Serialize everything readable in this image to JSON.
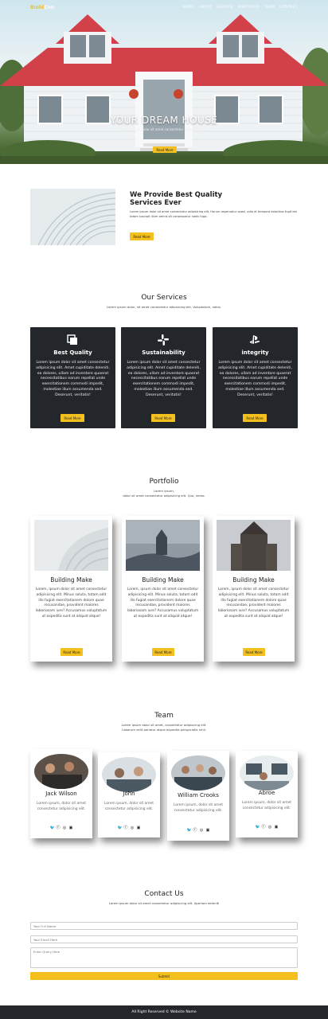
{
  "nav": {
    "brand_part1": "Build",
    "brand_part2": "Con",
    "items": [
      "HOME",
      "ABOUT",
      "SERVICE",
      "PORTFOLIO",
      "TEAM",
      "CONTACT"
    ]
  },
  "hero": {
    "title": "YOUR DREAM HOUSE",
    "subtitle": "Lorem ipsum dolor sit amet consectetur adipisicing elit.",
    "button": "Read More"
  },
  "about": {
    "title_line1": "We Provide Best Quality",
    "title_line2": "Services Ever",
    "text": "Lorem ipsum dolor sit amet consectetur adipisicing elit. Harum aspernatur quasi, odio et tempora doloribus fugit est totam suscipit illum omnis sit consequatur nobis fuga.",
    "button": "Read More"
  },
  "services": {
    "title": "Our Services",
    "subtitle": "Lorem ipsum dolor, sit amet consectetur adipisicing elit. Voluptatum, nobis.",
    "cards": [
      {
        "icon": "copy-icon",
        "title": "Best Quality",
        "text": "Lorem ipsum dolor sit amet consectetur adipisicing elit. Amet cupiditate deleniti, ea dolores, ullam ad inventore quaerat necessitatibus earum repellat unde exercitationem commodi impedit, molestiae illum assumenda sed. Deserunt, veritatis!",
        "button": "Read More"
      },
      {
        "icon": "slack-icon",
        "title": "Sustainability",
        "text": "Lorem ipsum dolor sit amet consectetur adipisicing elit. Amet cupiditate deleniti, ea dolores, ullam ad inventore quaerat necessitatibus earum repellat unde exercitationem commodi impedit, molestiae illum assumenda sed. Deserunt, veritatis!",
        "button": "Read More"
      },
      {
        "icon": "playstation-icon",
        "title": "integrity",
        "text": "Lorem ipsum dolor sit amet consectetur adipisicing elit. Amet cupiditate deleniti, ea dolores, ullam ad inventore quaerat necessitatibus earum repellat unde exercitationem commodi impedit, molestiae illum assumenda sed. Deserunt, veritatis!",
        "button": "Read More"
      }
    ]
  },
  "portfolio": {
    "title": "Portfolio",
    "subtitle_line1": "Lorem ipsum,",
    "subtitle_line2": "dolor sit amet consectetur adipisicing elit. Quo, nemo.",
    "cards": [
      {
        "title": "Building Make",
        "text": "Lorem, ipsum dolor sit amet consectetur adipisicing elit. Minus soluta, totam odit illo fugiat exercitationem dolore quae recusandae, provident maiores laboriosam iure? Accusamus voluptatum ut expedita sunt at aliquid atque!",
        "button": "Read More"
      },
      {
        "title": "Building Make",
        "text": "Lorem, ipsum dolor sit amet consectetur adipisicing elit. Minus soluta, totam odit illo fugiat exercitationem dolore quae recusandae, provident maiores laboriosam iure? Accusamus voluptatum ut expedita sunt at aliquid atque!",
        "button": "Read More"
      },
      {
        "title": "Building Make",
        "text": "Lorem, ipsum dolor sit amet consectetur adipisicing elit. Minus soluta, totam odit illo fugiat exercitationem dolore quae recusandae, provident maiores laboriosam iure? Accusamus voluptatum ut expedita sunt at aliquid atque!",
        "button": "Read More"
      }
    ]
  },
  "team": {
    "title": "Team",
    "subtitle_line1": "Lorem ipsum dolor sit amet, consectetur adipisicing elit.",
    "subtitle_line2": "Laborum velit pariatur atque expedita perspiciatis nihil.",
    "members": [
      {
        "name": "Jack Wilson",
        "text": "Lorem ipsum, dolor sit amet consectetur adipisicing elit."
      },
      {
        "name": "John",
        "text": "Lorem ipsum, dolor sit amet consectetur adipisicing elit."
      },
      {
        "name": "William Crooks",
        "text": "Lorem ipsum, dolor sit amet consectetur adipisicing elit."
      },
      {
        "name": "Abroe",
        "text": "Lorem ipsum, dolor sit amet consectetur adipisicing elit."
      }
    ],
    "social_icons": [
      "twitter-icon",
      "facebook-icon",
      "instagram-icon",
      "linkedin-icon"
    ]
  },
  "contact": {
    "title": "Contact Us",
    "subtitle": "Lorem ipsum dolor sit amet consectetur adipisicing elit. Aperiam deleniti",
    "name_placeholder": "Your Full Name",
    "email_placeholder": "Your Email Here",
    "query_placeholder": "Enter Query Here",
    "submit": "Submit"
  },
  "footer": {
    "text": "All Right Reserved © Website Name"
  },
  "colors": {
    "accent": "#f4c01e",
    "dark": "#23272b"
  }
}
